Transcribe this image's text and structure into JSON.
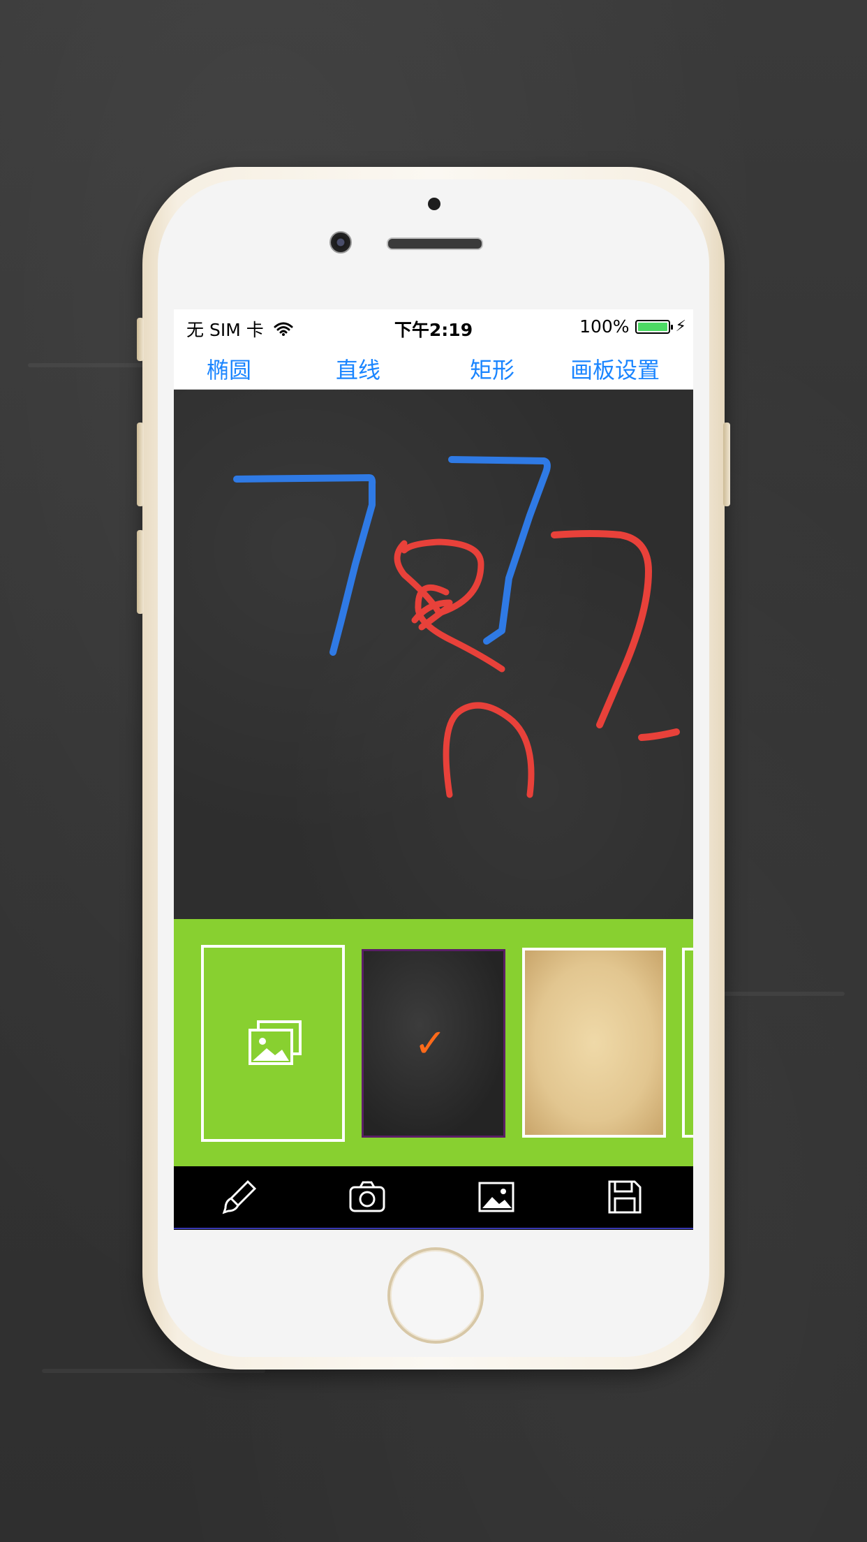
{
  "status_bar": {
    "carrier": "无 SIM 卡",
    "time": "下午2:19",
    "battery_percent": "100%",
    "battery_color": "#4cd964",
    "icons": [
      "wifi-icon",
      "battery-icon",
      "charging-bolt-icon"
    ]
  },
  "toolbar": {
    "items": [
      {
        "label": "椭圆"
      },
      {
        "label": "直线"
      },
      {
        "label": "矩形"
      },
      {
        "label": "画板设置"
      }
    ],
    "accent_color": "#1a85ff"
  },
  "canvas": {
    "background": "chalkboard",
    "stroke_colors": {
      "blue": "#2f7ae5",
      "red": "#e8413a"
    }
  },
  "background_picker": {
    "panel_color": "#88d030",
    "options": [
      {
        "name": "gallery",
        "icon": "gallery-icon"
      },
      {
        "name": "chalkboard",
        "selected": true,
        "icon": "checkmark-icon"
      },
      {
        "name": "parchment"
      },
      {
        "name": "more"
      }
    ]
  },
  "bottom_toolbar": {
    "icons": [
      "brush-icon",
      "camera-icon",
      "image-icon",
      "save-icon"
    ]
  }
}
